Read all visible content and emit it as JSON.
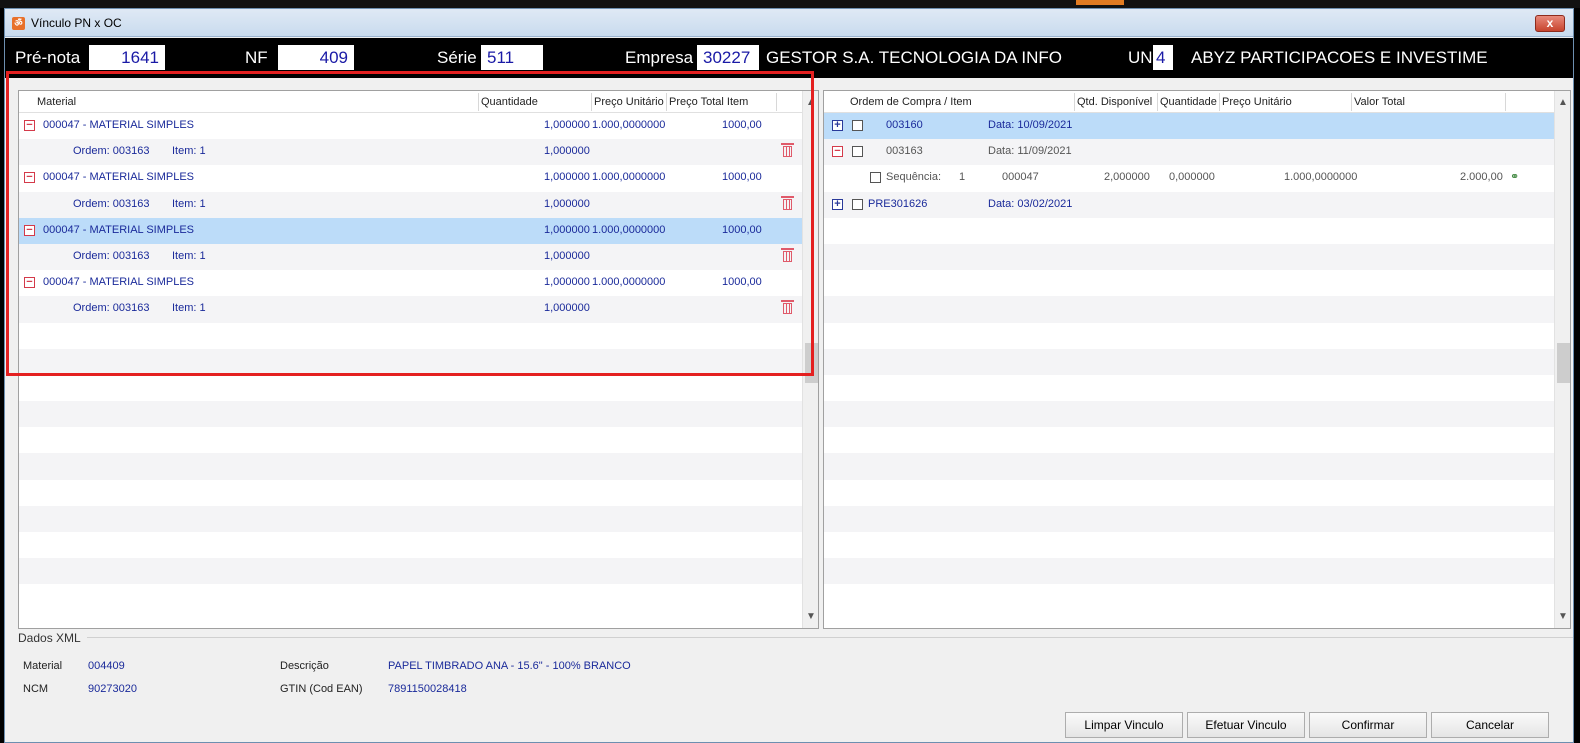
{
  "window": {
    "title": "Vínculo PN x OC",
    "close_label": "x"
  },
  "header": {
    "prenota_label": "Pré-nota",
    "prenota_value": "1641",
    "nf_label": "NF",
    "nf_value": "409",
    "serie_label": "Série",
    "serie_value": "511",
    "empresa_label": "Empresa",
    "empresa_code": "30227",
    "empresa_name": "GESTOR S.A. TECNOLOGIA DA INFO",
    "un_label": "UN",
    "un_code": "4",
    "un_name": "ABYZ PARTICIPACOES E INVESTIME"
  },
  "left_grid": {
    "columns": {
      "material": "Material",
      "quantidade": "Quantidade",
      "preco_unitario": "Preço Unitário",
      "preco_total": "Preço Total Item"
    },
    "rows": [
      {
        "kind": "material",
        "material": "000047 - MATERIAL SIMPLES",
        "quantidade": "1,000000",
        "preco_unitario": "1.000,0000000",
        "preco_total": "1000,00"
      },
      {
        "kind": "ordem",
        "ordem": "Ordem: 003163",
        "item": "Item: 1",
        "quantidade": "1,000000"
      },
      {
        "kind": "material",
        "material": "000047 - MATERIAL SIMPLES",
        "quantidade": "1,000000",
        "preco_unitario": "1.000,0000000",
        "preco_total": "1000,00"
      },
      {
        "kind": "ordem",
        "ordem": "Ordem: 003163",
        "item": "Item: 1",
        "quantidade": "1,000000"
      },
      {
        "kind": "material",
        "material": "000047 - MATERIAL SIMPLES",
        "quantidade": "1,000000",
        "preco_unitario": "1.000,0000000",
        "preco_total": "1000,00",
        "selected": true
      },
      {
        "kind": "ordem",
        "ordem": "Ordem: 003163",
        "item": "Item: 1",
        "quantidade": "1,000000"
      },
      {
        "kind": "material",
        "material": "000047 - MATERIAL SIMPLES",
        "quantidade": "1,000000",
        "preco_unitario": "1.000,0000000",
        "preco_total": "1000,00"
      },
      {
        "kind": "ordem",
        "ordem": "Ordem: 003163",
        "item": "Item: 1",
        "quantidade": "1,000000"
      }
    ]
  },
  "right_grid": {
    "columns": {
      "ordem_item": "Ordem de Compra / Item",
      "qtd_disponivel": "Qtd. Disponível",
      "quantidade": "Quantidade",
      "preco_unitario": "Preço Unitário",
      "valor_total": "Valor Total"
    },
    "rows": [
      {
        "kind": "order",
        "expander": "+",
        "order": "003160",
        "data": "Data: 10/09/2021",
        "selected": true
      },
      {
        "kind": "order",
        "expander": "−",
        "order": "003163",
        "data": "Data: 11/09/2021",
        "muted": true
      },
      {
        "kind": "seq",
        "seq_label": "Sequência:",
        "seq_num": "1",
        "material": "000047",
        "qtd_disponivel": "2,000000",
        "quantidade": "0,000000",
        "preco_unitario": "1.000,0000000",
        "valor_total": "2.000,00"
      },
      {
        "kind": "order",
        "expander": "+",
        "order": "PRE301626",
        "data": "Data: 03/02/2021"
      }
    ]
  },
  "xml": {
    "legend": "Dados XML",
    "material_label": "Material",
    "material_value": "004409",
    "ncm_label": "NCM",
    "ncm_value": "90273020",
    "descricao_label": "Descrição",
    "descricao_value": "PAPEL TIMBRADO ANA - 15.6\" - 100% BRANCO",
    "gtin_label": "GTIN (Cod EAN)",
    "gtin_value": "7891150028418"
  },
  "buttons": {
    "limpar": "Limpar Vinculo",
    "efetuar": "Efetuar Vinculo",
    "confirmar": "Confirmar",
    "cancelar": "Cancelar"
  },
  "colors": {
    "highlight": "#e42020",
    "selected_row": "#bcdcf9",
    "link_text": "#1a2a9a"
  }
}
